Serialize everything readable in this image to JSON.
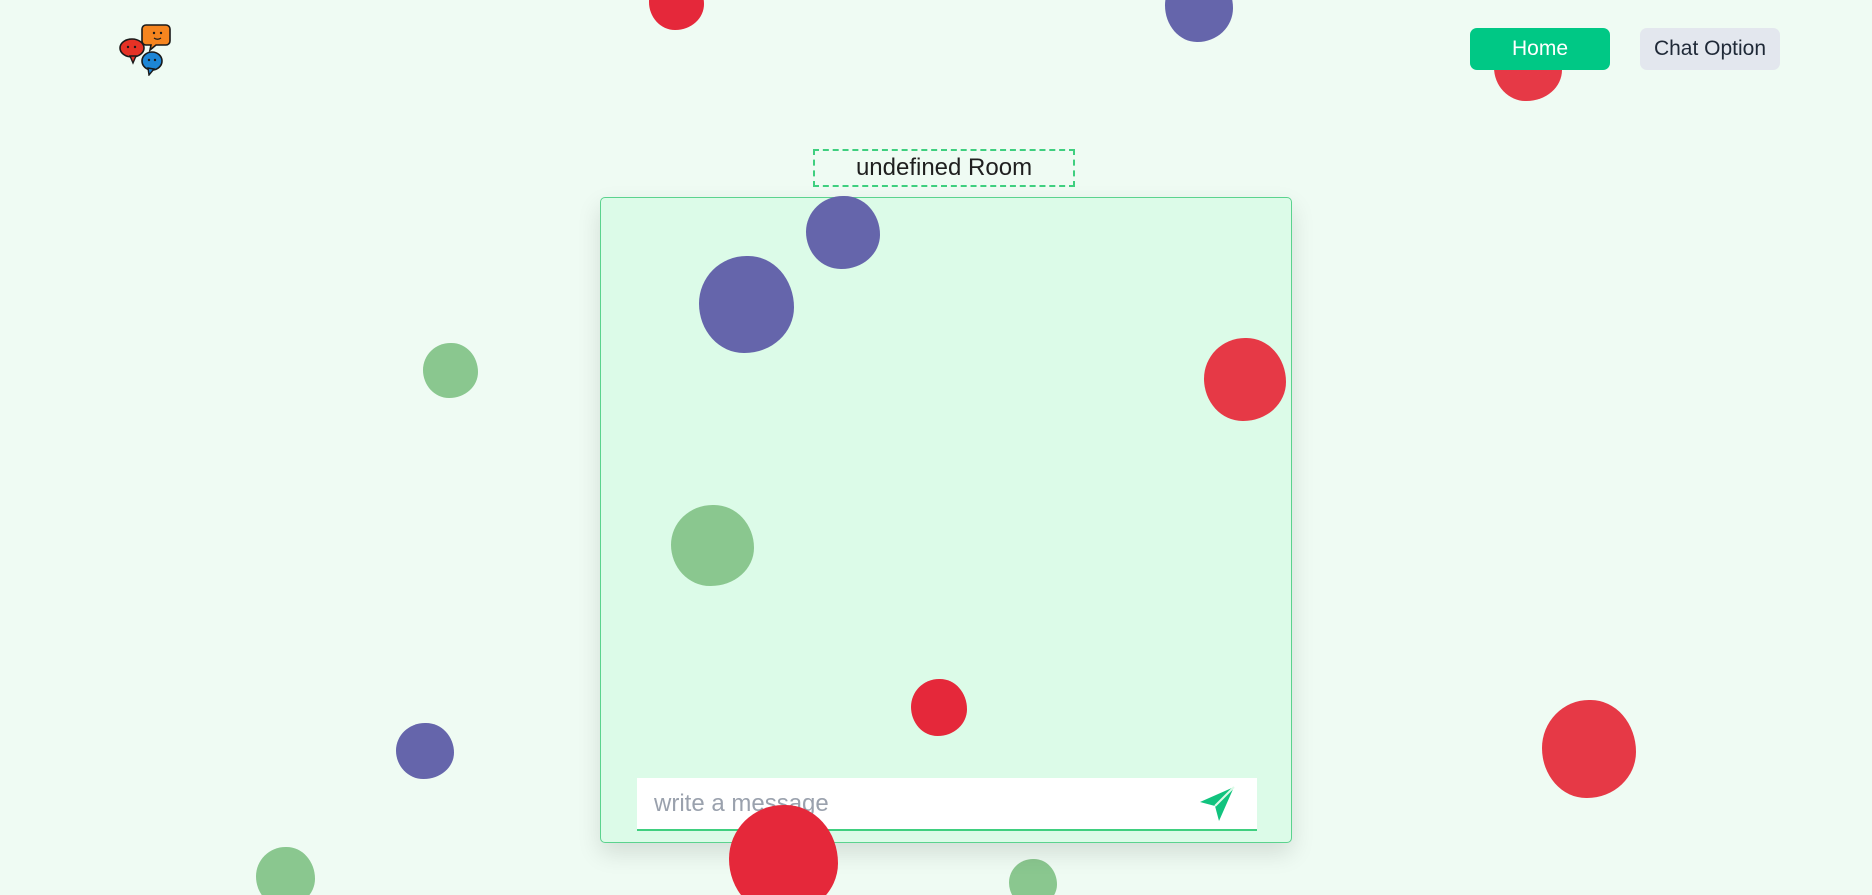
{
  "header": {
    "logo_icon": "chat-bubbles-icon",
    "nav": {
      "home_label": "Home",
      "chat_option_label": "Chat Option"
    }
  },
  "room": {
    "title": "undefined Room"
  },
  "composer": {
    "placeholder": "write a message",
    "value": "",
    "send_icon": "paper-plane-icon"
  },
  "colors": {
    "accent": "#00c885",
    "background": "#effbf3",
    "panel": "#dcfbe8",
    "blob_red": "#e63946",
    "blob_purple": "#6565ab",
    "blob_green": "#8ac78f"
  }
}
